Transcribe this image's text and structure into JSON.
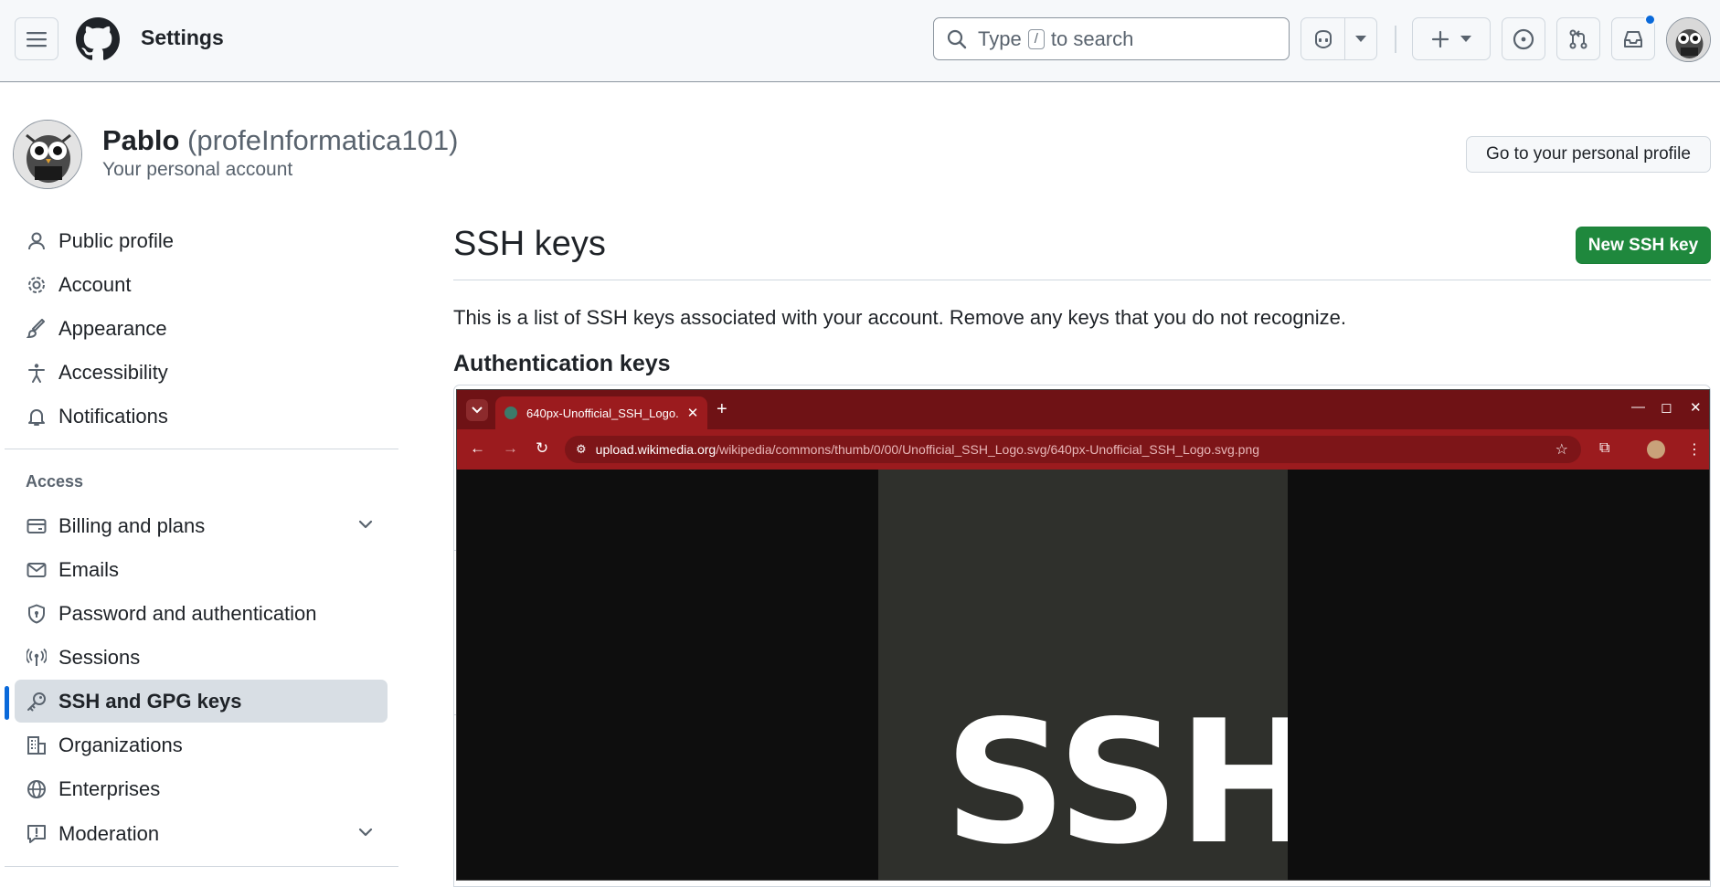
{
  "header": {
    "title": "Settings",
    "search": {
      "prefix": "Type",
      "key": "/",
      "suffix": "to search"
    }
  },
  "profile": {
    "name": "Pablo",
    "login": "(profeInformatica101)",
    "subtitle": "Your personal account",
    "go_profile_label": "Go to your personal profile"
  },
  "sidebar": {
    "items": [
      {
        "label": "Public profile",
        "icon": "person-icon"
      },
      {
        "label": "Account",
        "icon": "gear-icon"
      },
      {
        "label": "Appearance",
        "icon": "paintbrush-icon"
      },
      {
        "label": "Accessibility",
        "icon": "accessibility-icon"
      },
      {
        "label": "Notifications",
        "icon": "bell-icon"
      }
    ],
    "access_heading": "Access",
    "access_items": [
      {
        "label": "Billing and plans",
        "icon": "credit-card-icon",
        "expandable": true
      },
      {
        "label": "Emails",
        "icon": "mail-icon"
      },
      {
        "label": "Password and authentication",
        "icon": "shield-lock-icon"
      },
      {
        "label": "Sessions",
        "icon": "broadcast-icon"
      },
      {
        "label": "SSH and GPG keys",
        "icon": "key-icon",
        "active": true
      },
      {
        "label": "Organizations",
        "icon": "organization-icon"
      },
      {
        "label": "Enterprises",
        "icon": "globe-icon"
      },
      {
        "label": "Moderation",
        "icon": "report-icon",
        "expandable": true
      }
    ]
  },
  "main": {
    "title": "SSH keys",
    "new_key_label": "New SSH key",
    "description": "This is a list of SSH keys associated with your account. Remove any keys that you do not recognize.",
    "section_title": "Authentication keys"
  },
  "browser": {
    "tab_title": "640px-Unofficial_SSH_Logo.",
    "url_host": "upload.wikimedia.org",
    "url_path": "/wikipedia/commons/thumb/0/00/Unofficial_SSH_Logo.svg/640px-Unofficial_SSH_Logo.svg.png",
    "image_text": "SSH"
  },
  "colors": {
    "accent": "#0969da",
    "primary_button": "#1f883d",
    "browser_frame": "#9b1b1e",
    "active_nav_bg": "#d8dee4"
  }
}
